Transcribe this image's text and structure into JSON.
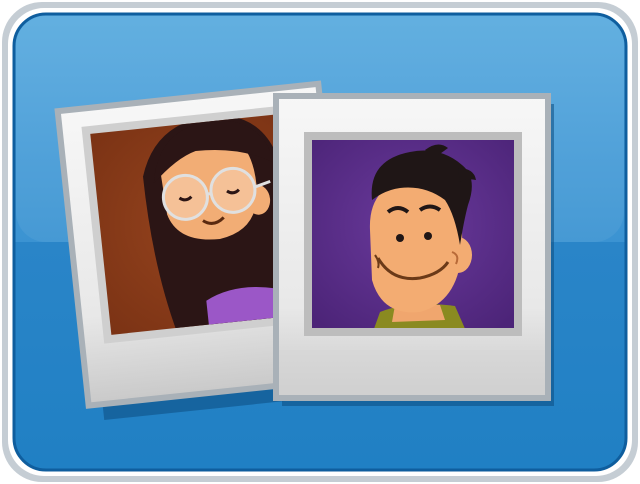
{
  "colors": {
    "tile_border_outer": "#b9c3cc",
    "tile_border_inner": "#ffffff",
    "tile_blue_top": "#4a9fd6",
    "tile_blue_bottom": "#1f7cc2",
    "tile_blue_edge": "#0d5fa0",
    "photo_frame": "#f4f4f4",
    "photo_frame_shadow": "#9aa5ad",
    "girl_background": "#8a3a1a",
    "boy_background": "#5b2d8a",
    "skin": "#f3b27a",
    "hair": "#2a1616",
    "shirt_boy": "#8a8a1e",
    "shirt_girl": "#9b57c7"
  },
  "icons": {
    "main": "photo-album-icon",
    "girl_photo": "girl-portrait-photo",
    "boy_photo": "boy-portrait-photo"
  }
}
